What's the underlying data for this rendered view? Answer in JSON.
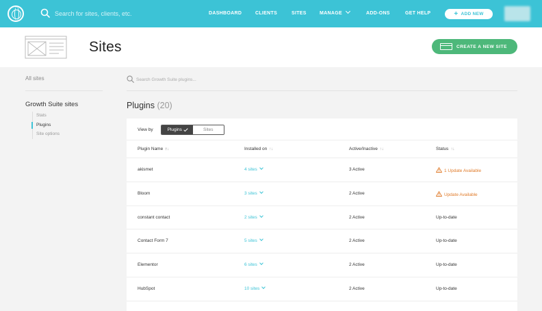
{
  "topbar": {
    "search_placeholder": "Search for sites, clients, etc.",
    "nav": {
      "dashboard": "DASHBOARD",
      "clients": "CLIENTS",
      "sites": "SITES",
      "manage": "MANAGE",
      "addons": "ADD-ONS",
      "help": "GET HELP"
    },
    "add_new": "ADD NEW",
    "accent_color": "#3cc3d6"
  },
  "header": {
    "title": "Sites",
    "create_button": "CREATE A NEW SITE",
    "create_button_color": "#4db87a"
  },
  "sidebar": {
    "all_sites": "All sites",
    "group_title": "Growth Suite sites",
    "items": [
      {
        "label": "Stats",
        "active": false
      },
      {
        "label": "Plugins",
        "active": true
      },
      {
        "label": "Site options",
        "active": false
      }
    ]
  },
  "main": {
    "search_placeholder": "Search Growth Suite plugins...",
    "title": "Plugins",
    "count": "(20)",
    "view_by": {
      "label": "View by",
      "options": [
        "Plugins",
        "Sites"
      ],
      "selected": "Plugins"
    },
    "columns": [
      "Plugin Name",
      "Installed on",
      "Active/Inactive",
      "Status"
    ],
    "rows": [
      {
        "name": "akismet",
        "installed": "4 sites",
        "active": "3 Active",
        "status": "1 Update Available",
        "warning": true
      },
      {
        "name": "Bloom",
        "installed": "3 sites",
        "active": "2 Active",
        "status": "Update Available",
        "warning": true
      },
      {
        "name": "constant contact",
        "installed": "2 sites",
        "active": "2 Active",
        "status": "Up-to-date",
        "warning": false
      },
      {
        "name": "Contact Form 7",
        "installed": "5 sites",
        "active": "2 Active",
        "status": "Up-to-date",
        "warning": false
      },
      {
        "name": "Elementor",
        "installed": "6 sites",
        "active": "2 Active",
        "status": "Up-to-date",
        "warning": false
      },
      {
        "name": "HubSpot",
        "installed": "10 sites",
        "active": "2 Active",
        "status": "Up-to-date",
        "warning": false
      }
    ],
    "warning_color": "#e07b2a"
  }
}
